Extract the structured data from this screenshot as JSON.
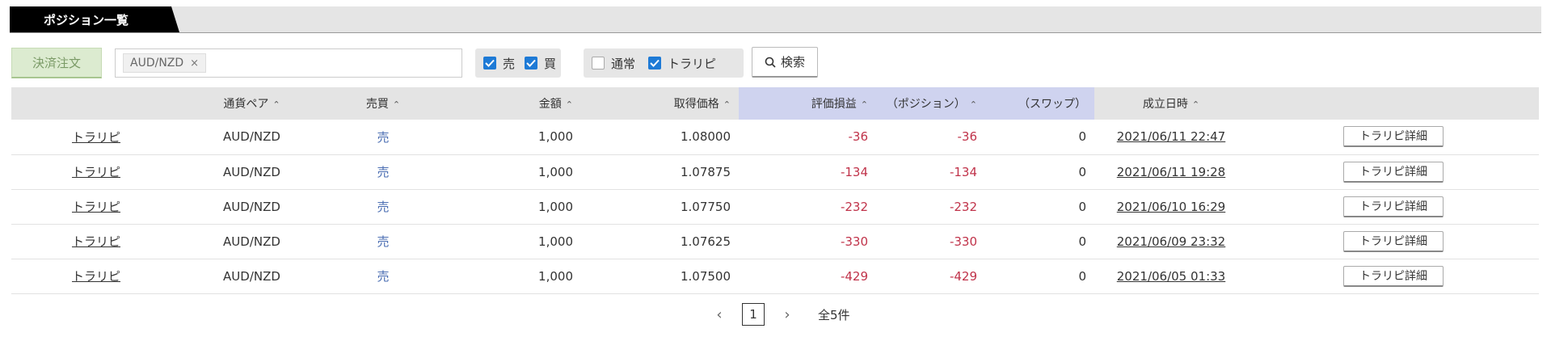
{
  "title": "ポジション一覧",
  "toolbar": {
    "settle_label": "決済注文",
    "pair_tag": "AUD/NZD",
    "tag_remove": "×",
    "side_sell": "売",
    "side_buy": "買",
    "type_normal": "通常",
    "type_trap": "トラリピ",
    "search_label": "検索"
  },
  "checkboxes": {
    "sell": true,
    "buy": true,
    "normal": false,
    "trap": true
  },
  "table": {
    "headers": [
      "",
      "通貨ペア",
      "売買",
      "金額",
      "取得価格",
      "評価損益",
      "（ポジション）",
      "（スワップ）",
      "成立日時",
      ""
    ],
    "sort_glyph": "⌃⌄",
    "rows": [
      {
        "kind": "トラリピ",
        "pair": "AUD/NZD",
        "side": "売",
        "amount": "1,000",
        "price": "1.08000",
        "pl": "-36",
        "pos": "-36",
        "swap": "0",
        "date": "2021/06/11 22:47",
        "btn": "トラリピ詳細"
      },
      {
        "kind": "トラリピ",
        "pair": "AUD/NZD",
        "side": "売",
        "amount": "1,000",
        "price": "1.07875",
        "pl": "-134",
        "pos": "-134",
        "swap": "0",
        "date": "2021/06/11 19:28",
        "btn": "トラリピ詳細"
      },
      {
        "kind": "トラリピ",
        "pair": "AUD/NZD",
        "side": "売",
        "amount": "1,000",
        "price": "1.07750",
        "pl": "-232",
        "pos": "-232",
        "swap": "0",
        "date": "2021/06/10 16:29",
        "btn": "トラリピ詳細"
      },
      {
        "kind": "トラリピ",
        "pair": "AUD/NZD",
        "side": "売",
        "amount": "1,000",
        "price": "1.07625",
        "pl": "-330",
        "pos": "-330",
        "swap": "0",
        "date": "2021/06/09 23:32",
        "btn": "トラリピ詳細"
      },
      {
        "kind": "トラリピ",
        "pair": "AUD/NZD",
        "side": "売",
        "amount": "1,000",
        "price": "1.07500",
        "pl": "-429",
        "pos": "-429",
        "swap": "0",
        "date": "2021/06/05 01:33",
        "btn": "トラリピ詳細"
      }
    ]
  },
  "pager": {
    "prev": "‹",
    "current": "1",
    "next": "›",
    "total": "全5件"
  },
  "colors": {
    "accent": "#1e7ad6",
    "negative": "#c0334a",
    "sell": "#4a6db2",
    "highlight_header": "#cfd3ef"
  }
}
